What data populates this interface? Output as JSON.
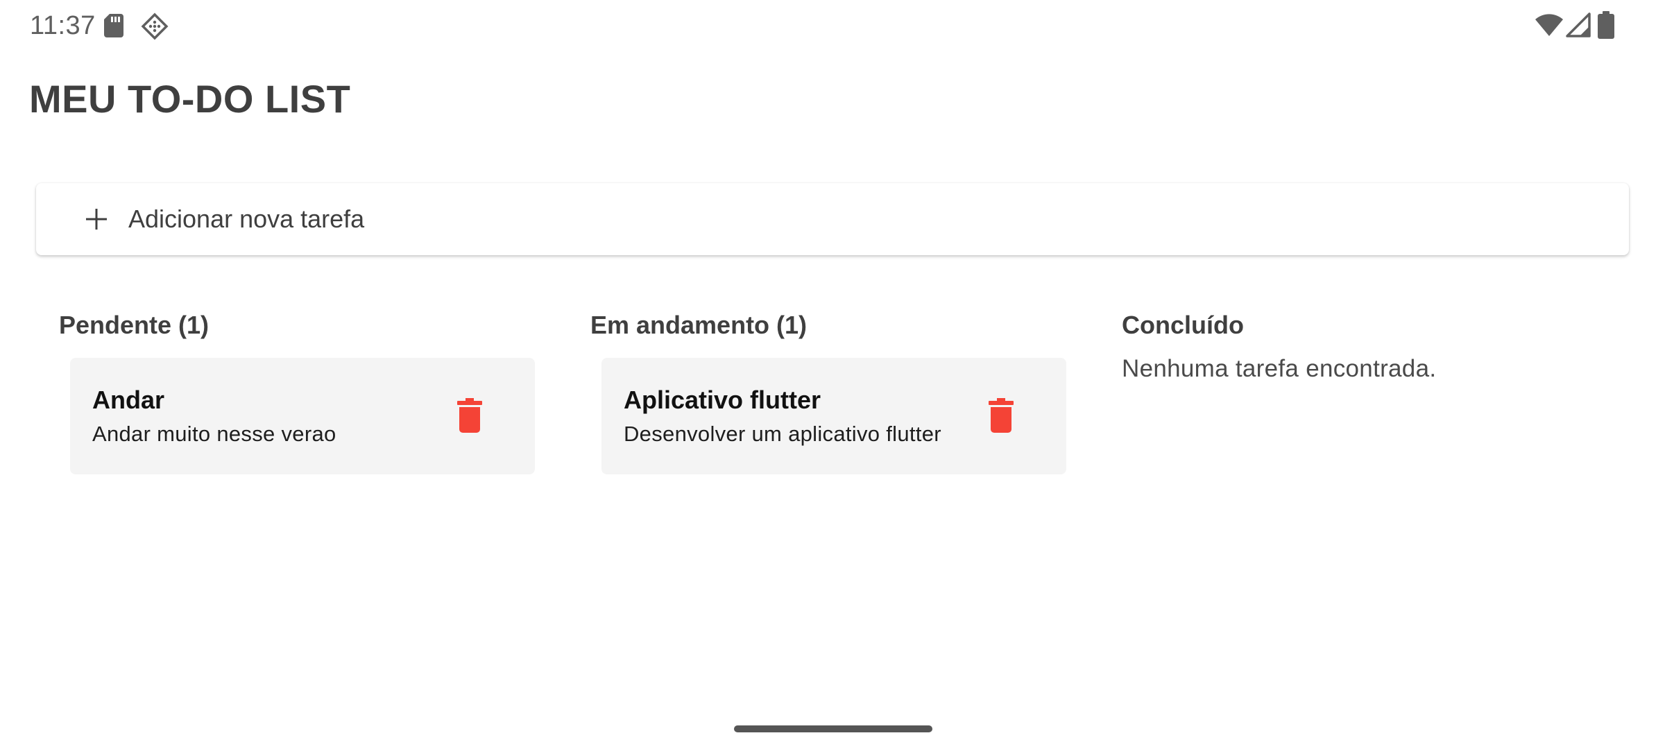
{
  "status_bar": {
    "time": "11:37",
    "icons": [
      "sd-card-icon",
      "debug-icon",
      "wifi-icon",
      "cellular-signal-icon",
      "battery-icon"
    ]
  },
  "app": {
    "title": "MEU TO-DO LIST"
  },
  "add_task": {
    "icon": "plus-icon",
    "label": "Adicionar nova tarefa"
  },
  "columns": [
    {
      "header": "Pendente (1)",
      "tasks": [
        {
          "title": "Andar",
          "description": "Andar muito nesse verao",
          "delete_icon": "trash-icon"
        }
      ]
    },
    {
      "header": "Em andamento (1)",
      "tasks": [
        {
          "title": "Aplicativo flutter",
          "description": "Desenvolver um aplicativo flutter",
          "delete_icon": "trash-icon"
        }
      ]
    },
    {
      "header": "Concluído",
      "empty_message": "Nenhuma tarefa encontrada.",
      "tasks": []
    }
  ],
  "colors": {
    "delete": "#f44336",
    "card_background": "#f4f4f4",
    "text": "#3f3f3f"
  }
}
